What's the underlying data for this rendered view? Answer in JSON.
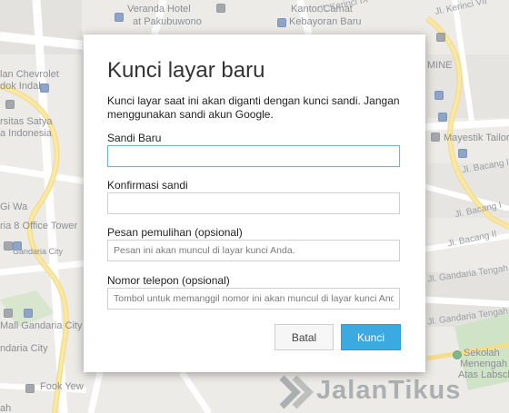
{
  "map": {
    "labels": {
      "veranda": "Veranda Hotel",
      "pakubuwono": "at Pakubuwono",
      "kantor_camat": "Kantor Camat",
      "kebayoran": "Kebayoran Baru",
      "kerinci_ix": "Jl. Kerinci IX",
      "kerinci_vii": "Jl. Kerinci VII",
      "mine": "MINE",
      "chevrolet": "lan Chevrolet",
      "pondok_indah": "dok Indah",
      "satya": "rsitas Satya",
      "indonesia": "a Indonesia",
      "mayestik": "Mayestik Tailor",
      "bacang1": "Jl. Bacang I",
      "bacang_i": "Jl. Bacang I",
      "bacang_ii": "Jl. Bacang II",
      "wa": "Gi Wa",
      "tower": "ria 8 Office Tower",
      "gandaria_city": "Gandaria City",
      "gandaria_tengah": "Jl. Gandaria Tengah II",
      "gandaria_tengah_ii": "Jl. Gandaria Tengah II",
      "mall": "Mall Gandaria City",
      "gandaria_city2": "ndaria City",
      "sekolah": "Sekolah",
      "menengah": "Menengah",
      "atas": "Atas Labschool",
      "fook": "Fook Yew",
      "ah": "ah"
    }
  },
  "dialog": {
    "title": "Kunci layar baru",
    "description": "Kunci layar saat ini akan diganti dengan kunci sandi. Jangan menggunakan sandi akun Google.",
    "new_password": {
      "label": "Sandi Baru",
      "value": "",
      "placeholder": ""
    },
    "confirm_password": {
      "label": "Konfirmasi sandi",
      "value": "",
      "placeholder": ""
    },
    "recovery_message": {
      "label": "Pesan pemulihan (opsional)",
      "value": "",
      "placeholder": "Pesan ini akan muncul di layar kunci Anda."
    },
    "phone_number": {
      "label": "Nomor telepon (opsional)",
      "value": "",
      "placeholder": "Tombol untuk memanggil nomor ini akan muncul di layar kunci Anda."
    },
    "cancel_label": "Batal",
    "lock_label": "Kunci"
  },
  "watermark": {
    "text": "JalanTikus"
  },
  "colors": {
    "accent": "#3aaae0",
    "focus_border": "#6fb1e0"
  }
}
